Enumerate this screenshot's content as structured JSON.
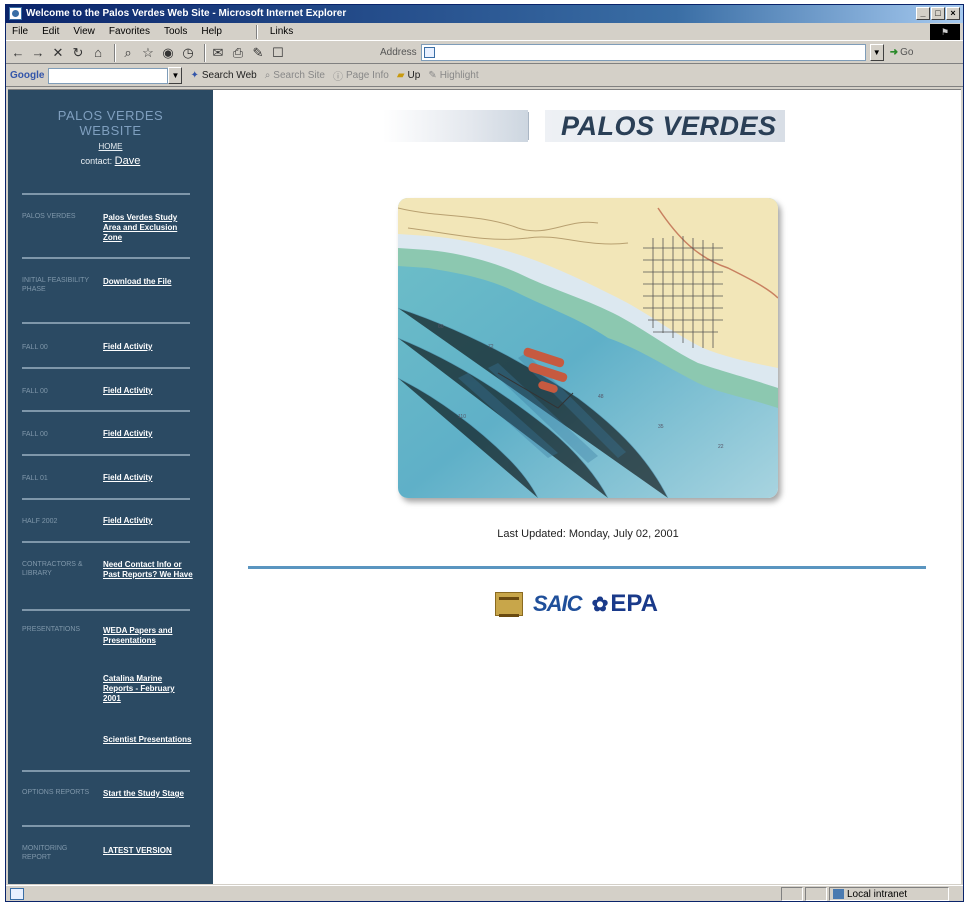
{
  "window": {
    "title": "Welcome to the Palos Verdes Web Site - Microsoft Internet Explorer",
    "controls": [
      "_",
      "□",
      "×"
    ]
  },
  "menubar": {
    "items": [
      "File",
      "Edit",
      "View",
      "Favorites",
      "Tools",
      "Help"
    ],
    "links_label": "Links"
  },
  "toolbar": {
    "icons": [
      "back-icon",
      "forward-icon",
      "stop-icon",
      "refresh-icon",
      "home-icon",
      "search-icon",
      "favorites-icon",
      "media-icon",
      "history-icon",
      "mail-icon",
      "print-icon",
      "edit-icon",
      "discuss-icon"
    ],
    "address_label": "Address",
    "address_value": "",
    "go_label": "Go"
  },
  "googlebar": {
    "logo": "Google",
    "search_web_label": "Search Web",
    "search_site_label": "Search Site",
    "page_info_label": "Page Info",
    "up_label": "Up",
    "highlight_label": "Highlight"
  },
  "sidebar": {
    "title_line1": "PALOS VERDES",
    "title_line2": "WEBSITE",
    "home": "HOME",
    "contact_prefix": "contact:",
    "contact_name": "Dave",
    "sections": [
      {
        "category": "PALOS VERDES",
        "links": [
          "Palos Verdes Study Area and Exclusion Zone"
        ]
      },
      {
        "category": "INITIAL FEASIBILITY PHASE",
        "links": [
          "Download the File"
        ]
      },
      {
        "category": "FALL 00",
        "links": [
          "Field Activity"
        ]
      },
      {
        "category": "FALL 00",
        "links": [
          "Field Activity"
        ]
      },
      {
        "category": "FALL 00",
        "links": [
          "Field Activity"
        ]
      },
      {
        "category": "FALL 01",
        "links": [
          "Field Activity"
        ]
      },
      {
        "category": "HALF 2002",
        "links": [
          "Field Activity"
        ]
      },
      {
        "category": "CONTRACTORS & LIBRARY",
        "links": [
          "Need Contact Info or Past Reports? We Have"
        ]
      },
      {
        "category": "PRESENTATIONS",
        "links": [
          "WEDA Papers and Presentations",
          "Catalina Marine Reports - February 2001",
          "Scientist Presentations"
        ]
      },
      {
        "category": "OPTIONS REPORTS",
        "links": [
          "Start the Study Stage"
        ]
      },
      {
        "category": "MONITORING REPORT",
        "links": [
          "LATEST VERSION"
        ]
      }
    ]
  },
  "main": {
    "banner_text": "PALOS VERDES",
    "map_alt": "Nautical chart of the Palos Verdes shelf",
    "last_updated": "Last Updated: Monday, July 02, 2001",
    "logos": {
      "usace": "US Army Corps of Engineers",
      "saic": "SAIC",
      "epa": "EPA"
    }
  },
  "statusbar": {
    "text": "",
    "zone": "Local intranet"
  }
}
